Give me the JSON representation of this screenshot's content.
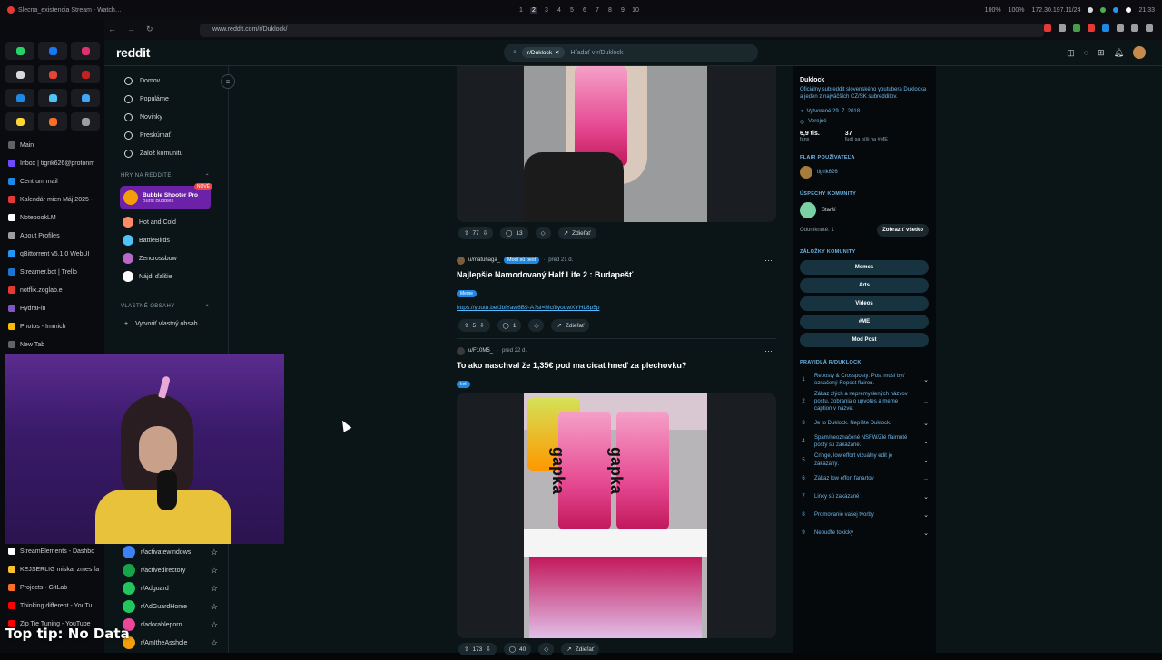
{
  "topbar": {
    "window_title": "Slecna_existencia Stream - Watch…",
    "workspaces": [
      "1",
      "2",
      "3",
      "4",
      "5",
      "6",
      "7",
      "8",
      "9",
      "10"
    ],
    "active_workspace": "2",
    "tray": {
      "volume1": "100%",
      "volume2": "100%",
      "ip": "172.30.197.11/24",
      "time": "21:33"
    }
  },
  "left_tabs": [
    {
      "label": "Main",
      "color": "#5f6368"
    },
    {
      "label": "Inbox | tigrik626@protonm",
      "color": "#6d4aff"
    },
    {
      "label": "Centrum mail",
      "color": "#1e88e5"
    },
    {
      "label": "Kalendár mien Máj 2025 -",
      "color": "#e53935"
    },
    {
      "label": "NotebookLM",
      "color": "#ffffff"
    },
    {
      "label": "About Profiles",
      "color": "#9e9e9e"
    },
    {
      "label": "qBittorrent v5.1.0 WebUI",
      "color": "#2196f3"
    },
    {
      "label": "Streamer.bot | Trello",
      "color": "#1976d2"
    },
    {
      "label": "notflix.zoglab.e",
      "color": "#e53935"
    },
    {
      "label": "HydraFin",
      "color": "#7e57c2"
    },
    {
      "label": "Photos - Immich",
      "color": "#fbbc04"
    },
    {
      "label": "New Tab",
      "color": "#5f6368"
    }
  ],
  "left_tabs_bottom": [
    {
      "label": "StreamElements - Dashbo",
      "color": "#ffffff"
    },
    {
      "label": "KEJSERLIG miska, zmes fa",
      "color": "#fbc02d"
    },
    {
      "label": "Projects · GitLab",
      "color": "#fc6d26"
    },
    {
      "label": "Thinking different - YouTu",
      "color": "#ff0000"
    },
    {
      "label": "Zip Tie Tuning - YouTube",
      "color": "#ff0000"
    }
  ],
  "browser": {
    "url": "www.reddit.com/r/Duklock/"
  },
  "reddit": {
    "logo": "reddit",
    "search_chip": "r/Duklock",
    "search_placeholder": "Hľadať v r/Duklock",
    "nav": [
      "Domov",
      "Populárne",
      "Novinky",
      "Preskúmať",
      "Založ komunitu"
    ],
    "games_header": "HRY NA REDDITE",
    "game_promo": {
      "title": "Bubble Shooter Pro",
      "subtitle": "Burst Bubbles",
      "badge": "NOVÉ"
    },
    "games": [
      "Hot and Cold",
      "BattleBirds",
      "Zencrossbow",
      "Nájdi ďalšie"
    ],
    "custom_feeds_header": "VLASTNÉ OBSAHY",
    "create_feed": "Vytvoriť vlastný obsah",
    "subs": [
      {
        "name": "r/activatewindows",
        "color": "#3b82f6"
      },
      {
        "name": "r/activedirectory",
        "color": "#16a34a"
      },
      {
        "name": "r/Adguard",
        "color": "#22c55e"
      },
      {
        "name": "r/AdGuardHome",
        "color": "#22c55e"
      },
      {
        "name": "r/adorableporn",
        "color": "#ec4899"
      },
      {
        "name": "r/AmItheAsshole",
        "color": "#f59e0b"
      }
    ]
  },
  "feed": {
    "post1_actions": {
      "votes": "77",
      "comments": "13",
      "share": "Zdieľať"
    },
    "post2": {
      "author": "u/matuhaga_",
      "flair": "Modi sú best",
      "time": "pred 21 d.",
      "title": "Najlepšie Namodovaný Half Life 2 : Budapešť",
      "tag": "Meme",
      "link": "https://youtu.be/JbfYaw6B9-A?si=McffiyodwXYHL8p5p",
      "votes": "5",
      "comments": "1",
      "share": "Zdieľať"
    },
    "post3": {
      "author": "u/F10M5_",
      "time": "pred 22 d.",
      "title": "To ako naschval že 1,35€ pod ma cicat hneď za plechovku?",
      "tag": "Iné",
      "can_text": "gapka",
      "votes": "173",
      "comments": "40",
      "share": "Zdieľať"
    }
  },
  "about": {
    "name": "Duklock",
    "description": "Oficiálny subreddit slovenského youtubera Duklocka a jeden z najväčších CZ/SK subredditov.",
    "created": "Vytvorené 29. 7. 2018",
    "visibility": "Verejné",
    "members": "6,9 tis.",
    "members_label": "fans",
    "online": "37",
    "online_label": "ľudí sa píši na #ME",
    "flair_header": "FLAIR POUŽÍVATEĽA",
    "username": "tigrik626",
    "achievements_header": "ÚSPECHY KOMUNITY",
    "achievement": "Starší",
    "unlocked": "Odomknuté: 1",
    "show_all": "Zobraziť všetko",
    "bookmarks_header": "ZÁLOŽKY KOMUNITY",
    "bookmarks": [
      "Memes",
      "Arts",
      "Videos",
      "#ME",
      "Mod Post"
    ],
    "rules_header": "PRAVIDLÁ R/DUKLOCK",
    "rules": [
      "Reposty & Crossposty: Post musí byť označený Repost flairou.",
      "Zákaz zlých a nepremyslených názvov postu, žobrania o upvotes a meme caption v názve.",
      "Je to Duklock. Nepíšte Duklock.",
      "Spam/neoznačené NSFW/Zlé flairnuté posty sú zakázané.",
      "Cringe, low effort vizuálny edit je zakázaný.",
      "Zákaz low effort fanartov",
      "Linky sú zakázané",
      "Promovanie vašej tvorby",
      "Nebuďte toxický"
    ]
  },
  "overlay": {
    "top_tip": "Top tip: No Data"
  }
}
